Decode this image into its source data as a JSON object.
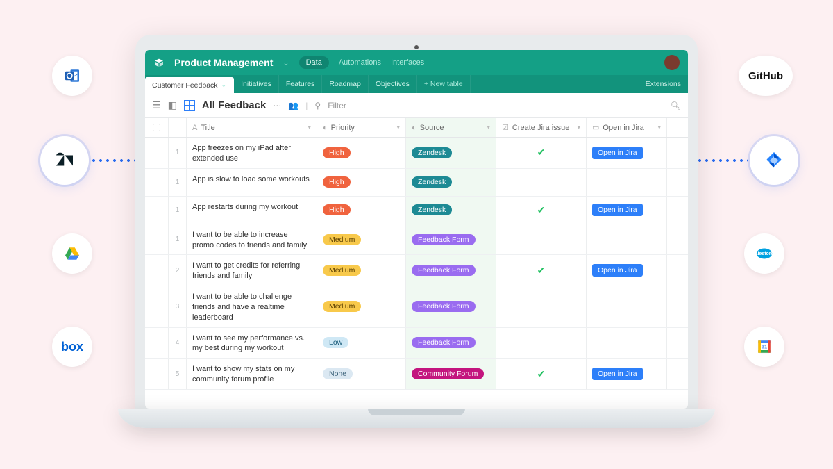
{
  "integrations": {
    "outlook": "Outlook",
    "zendesk": "Zendesk",
    "googledrive": "Google Drive",
    "box": "box",
    "github": "GitHub",
    "jira": "Jira",
    "salesforce": "salesforce",
    "gcal": "Google Calendar"
  },
  "header": {
    "workspace": "Product Management",
    "nav": [
      "Data",
      "Automations",
      "Interfaces"
    ]
  },
  "tabs": {
    "items": [
      "Customer Feedback",
      "Initiatives",
      "Features",
      "Roadmap",
      "Objectives"
    ],
    "add": "+  New table",
    "extensions": "Extensions"
  },
  "viewbar": {
    "name": "All Feedback",
    "filter": "Filter"
  },
  "columns": {
    "title": "Title",
    "priority": "Priority",
    "source": "Source",
    "create_jira": "Create Jira issue",
    "open_jira": "Open in Jira"
  },
  "jira_button_label": "Open in Jira",
  "rows": [
    {
      "num": "1",
      "title": "App freezes on my iPad after extended use",
      "priority": "High",
      "pclass": "pri-high",
      "source": "Zendesk",
      "sclass": "src-zendesk",
      "created": true,
      "open": true
    },
    {
      "num": "1",
      "title": "App is slow to load some workouts",
      "priority": "High",
      "pclass": "pri-high",
      "source": "Zendesk",
      "sclass": "src-zendesk",
      "created": false,
      "open": false
    },
    {
      "num": "1",
      "title": "App restarts during my workout",
      "priority": "High",
      "pclass": "pri-high",
      "source": "Zendesk",
      "sclass": "src-zendesk",
      "created": true,
      "open": true
    },
    {
      "num": "1",
      "title": "I want to be able to increase promo codes to friends and family",
      "priority": "Medium",
      "pclass": "pri-medium",
      "source": "Feedback Form",
      "sclass": "src-feedback",
      "created": false,
      "open": false
    },
    {
      "num": "2",
      "title": "I want to get credits for referring friends and family",
      "priority": "Medium",
      "pclass": "pri-medium",
      "source": "Feedback Form",
      "sclass": "src-feedback",
      "created": true,
      "open": true
    },
    {
      "num": "3",
      "title": "I want to be able to challenge friends and have a realtime leaderboard",
      "priority": "Medium",
      "pclass": "pri-medium",
      "source": "Feedback Form",
      "sclass": "src-feedback",
      "created": false,
      "open": false
    },
    {
      "num": "4",
      "title": "I want to see my performance vs. my best during my workout",
      "priority": "Low",
      "pclass": "pri-low",
      "source": "Feedback Form",
      "sclass": "src-feedback",
      "created": false,
      "open": false
    },
    {
      "num": "5",
      "title": "I want to show my stats on my community forum profile",
      "priority": "None",
      "pclass": "pri-none",
      "source": "Community Forum",
      "sclass": "src-community",
      "created": true,
      "open": true
    }
  ]
}
